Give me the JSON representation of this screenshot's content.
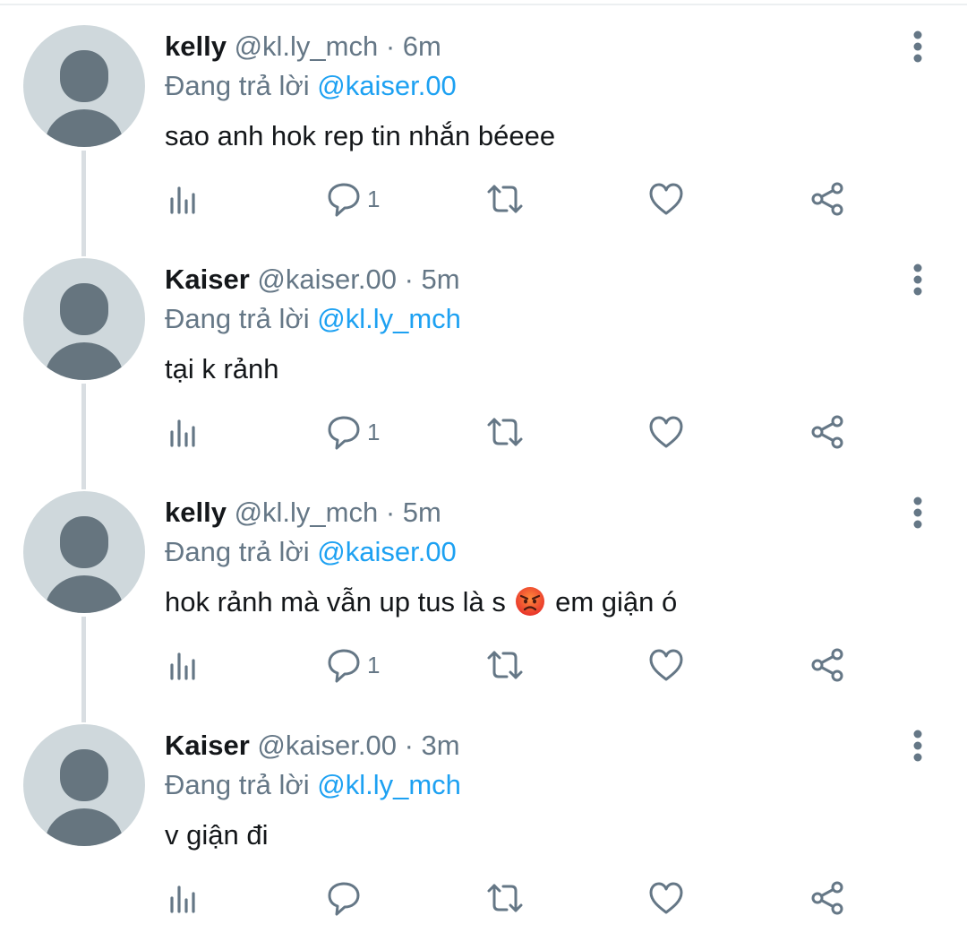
{
  "colors": {
    "name": "#14171a",
    "secondary": "#657786",
    "mention": "#1da1f2",
    "avatar_bg": "#cfd8dc",
    "avatar_fg": "#66757f",
    "thread_line": "#d9dee2"
  },
  "icons": {
    "stats": "bar-chart-icon",
    "reply": "speech-bubble-icon",
    "retweet": "retweet-icon",
    "like": "heart-icon",
    "share": "share-icon",
    "more": "vertical-ellipsis-icon",
    "emoji": "angry-face-emoji"
  },
  "tweets": [
    {
      "name": "kelly",
      "handle": "@kl.ly_mch",
      "time": "· 6m",
      "replying_label": "Đang trả lời",
      "replying_to": "@kaiser.00",
      "text": "sao anh hok rep tin nhắn béeee",
      "reply_count": "1"
    },
    {
      "name": "Kaiser",
      "handle": "@kaiser.00",
      "time": "· 5m",
      "replying_label": "Đang trả lời",
      "replying_to": "@kl.ly_mch",
      "text": "tại k rảnh",
      "reply_count": "1"
    },
    {
      "name": "kelly",
      "handle": "@kl.ly_mch",
      "time": "· 5m",
      "replying_label": "Đang trả lời",
      "replying_to": "@kaiser.00",
      "text_before": "hok rảnh mà vẫn up tus là s",
      "text_after": "em giận ó",
      "reply_count": "1"
    },
    {
      "name": "Kaiser",
      "handle": "@kaiser.00",
      "time": "· 3m",
      "replying_label": "Đang trả lời",
      "replying_to": "@kl.ly_mch",
      "text": "v giận đi",
      "reply_count": ""
    }
  ]
}
